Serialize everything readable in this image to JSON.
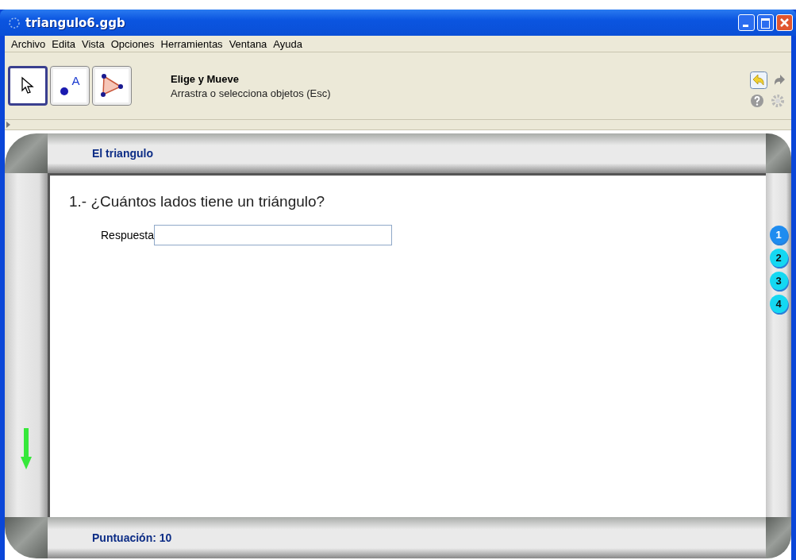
{
  "window": {
    "title": "triangulo6.ggb"
  },
  "menu": [
    "Archivo",
    "Edita",
    "Vista",
    "Opciones",
    "Herramientas",
    "Ventana",
    "Ayuda"
  ],
  "tools": [
    {
      "kind": "move",
      "selected": true
    },
    {
      "kind": "point",
      "label": "A",
      "selected": false
    },
    {
      "kind": "polygon",
      "selected": false
    }
  ],
  "tool_info": {
    "title": "Elige y Mueve",
    "description": "Arrastra o selecciona objetos (Esc)"
  },
  "board": {
    "title": "El triangulo",
    "question": "1.- ¿Cuántos lados tiene un triángulo?",
    "answer_label": "Respuesta",
    "score": "Puntuación: 10"
  },
  "pages": [
    {
      "label": "1",
      "selected": true
    },
    {
      "label": "2",
      "selected": false
    },
    {
      "label": "3",
      "selected": false
    },
    {
      "label": "4",
      "selected": false
    }
  ]
}
